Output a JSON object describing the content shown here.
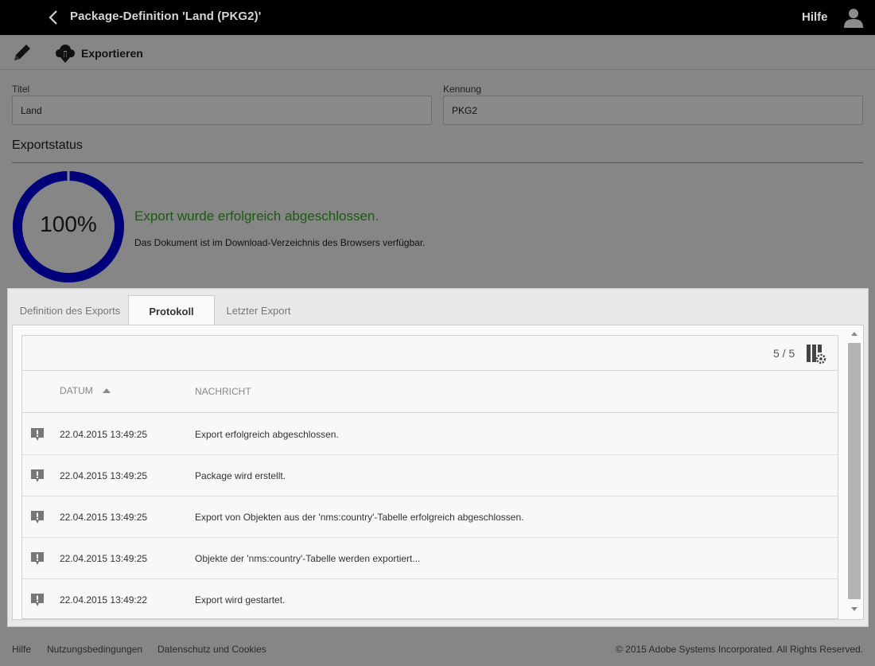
{
  "header": {
    "title": "Package-Definition 'Land (PKG2)'",
    "help": "Hilfe"
  },
  "toolbar": {
    "export_label": "Exportieren"
  },
  "form": {
    "title_label": "Titel",
    "title_value": "Land",
    "id_label": "Kennung",
    "id_value": "PKG2"
  },
  "export_status": {
    "heading": "Exportstatus",
    "progress_percent": 100,
    "progress_label": "100%",
    "message": "Export wurde erfolgreich abgeschlossen.",
    "sub_message": "Das Dokument ist im Download-Verzeichnis des Browsers verfügbar.",
    "ring_color": "#00007a",
    "message_color": "#1c5a12"
  },
  "tabs": [
    {
      "label": "Definition des Exports",
      "active": false
    },
    {
      "label": "Protokoll",
      "active": true
    },
    {
      "label": "Letzter Export",
      "active": false
    }
  ],
  "log": {
    "count": "5 / 5",
    "columns": {
      "date": "DATUM",
      "message": "NACHRICHT"
    },
    "sort": "date-ascending",
    "rows": [
      {
        "icon": "info-message-icon",
        "date": "22.04.2015 13:49:25",
        "message": "Export erfolgreich abgeschlossen."
      },
      {
        "icon": "info-message-icon",
        "date": "22.04.2015 13:49:25",
        "message": "Package wird erstellt."
      },
      {
        "icon": "info-message-icon",
        "date": "22.04.2015 13:49:25",
        "message": "Export von Objekten aus der 'nms:country'-Tabelle erfolgreich abgeschlossen."
      },
      {
        "icon": "info-message-icon",
        "date": "22.04.2015 13:49:25",
        "message": "Objekte der 'nms:country'-Tabelle werden exportiert..."
      },
      {
        "icon": "info-message-icon",
        "date": "22.04.2015 13:49:22",
        "message": "Export wird gestartet."
      }
    ]
  },
  "footer": {
    "links": [
      "Hilfe",
      "Nutzungsbedingungen",
      "Datenschutz und Cookies"
    ],
    "copyright": "© 2015 Adobe Systems Incorporated. All Rights Reserved."
  }
}
